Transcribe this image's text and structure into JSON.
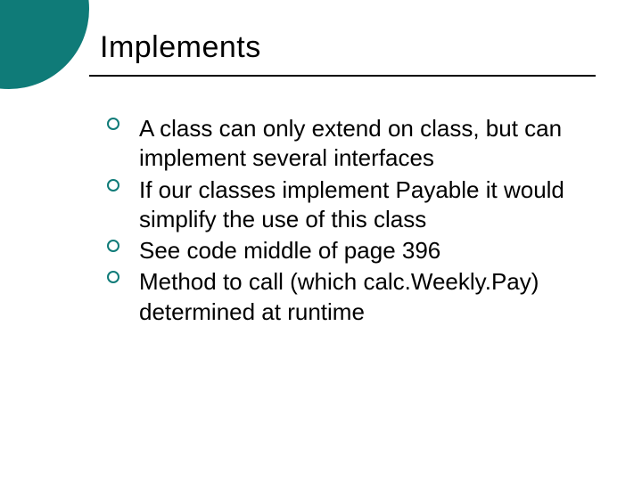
{
  "slide": {
    "title": "Implements",
    "bullets": [
      "A class can only extend on class, but can implement several interfaces",
      "If our classes implement Payable it would simplify the use of this class",
      "See code middle of page 396",
      "Method to call (which calc.Weekly.Pay) determined at runtime"
    ]
  },
  "colors": {
    "accent": "#0f7b78"
  }
}
